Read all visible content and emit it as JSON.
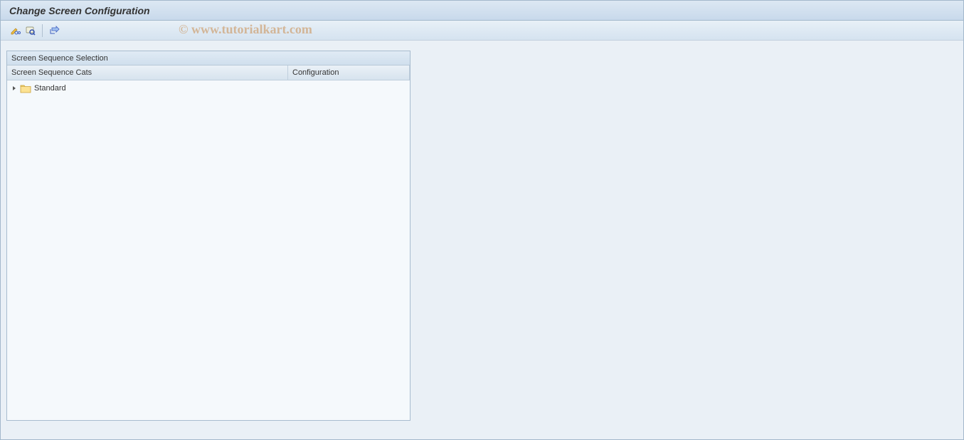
{
  "window": {
    "title": "Change Screen Configuration"
  },
  "toolbar": {
    "icon1_name": "pencil-glasses-icon",
    "icon2_name": "find-icon",
    "icon3_name": "share-icon"
  },
  "watermark": "© www.tutorialkart.com",
  "panel": {
    "title": "Screen Sequence Selection",
    "columns": {
      "col1": "Screen Sequence Cats",
      "col2": "Configuration"
    }
  },
  "tree": {
    "items": [
      {
        "label": "Standard",
        "type": "folder",
        "expanded": false
      }
    ]
  }
}
